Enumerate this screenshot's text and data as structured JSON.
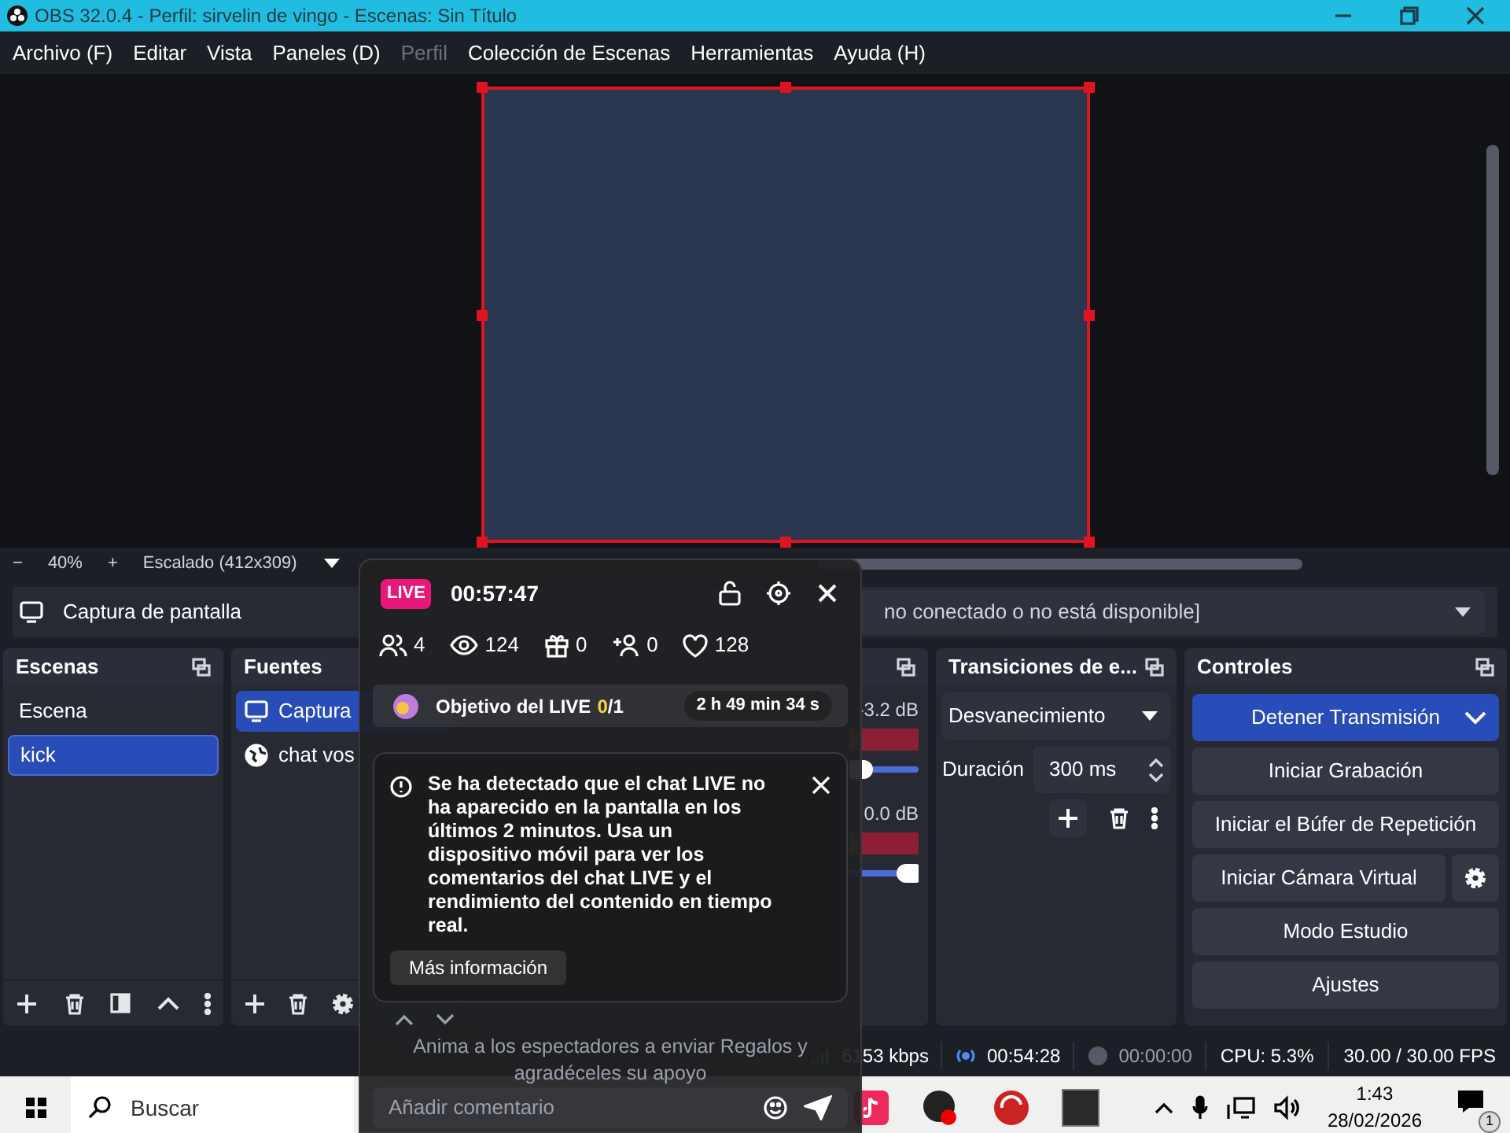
{
  "window": {
    "title": "OBS 32.0.4 - Perfil: sirvelin de vingo - Escenas: Sin Título"
  },
  "menu": [
    {
      "label": "Archivo (F)",
      "disabled": false
    },
    {
      "label": "Editar",
      "disabled": false
    },
    {
      "label": "Vista",
      "disabled": false
    },
    {
      "label": "Paneles (D)",
      "disabled": false
    },
    {
      "label": "Perfil",
      "disabled": true
    },
    {
      "label": "Colección de Escenas",
      "disabled": false
    },
    {
      "label": "Herramientas",
      "disabled": false
    },
    {
      "label": "Ayuda (H)",
      "disabled": false
    }
  ],
  "preview": {
    "zoom_out": "−",
    "zoom": "40%",
    "zoom_in": "+",
    "scale": "Escalado (412x309)"
  },
  "source_toolbar": {
    "source": "Captura de pantalla",
    "device": "no conectado o no está disponible]"
  },
  "scenes": {
    "title": "Escenas",
    "items": [
      {
        "label": "Escena",
        "selected": false
      },
      {
        "label": "kick",
        "selected": true
      }
    ]
  },
  "sources": {
    "title": "Fuentes",
    "items": [
      {
        "label": "Captura",
        "kind": "display",
        "selected": true
      },
      {
        "label": "chat vos",
        "kind": "browser",
        "selected": false
      }
    ]
  },
  "mixer": {
    "channels": [
      {
        "reading": "-3.2 dB",
        "level": 0.86
      },
      {
        "reading": "0.0 dB",
        "level": 0.98
      }
    ]
  },
  "transitions": {
    "title": "Transiciones de e...",
    "transition": "Desvanecimiento",
    "duration_label": "Duración",
    "duration": "300 ms"
  },
  "controls": {
    "title": "Controles",
    "buttons": [
      {
        "label": "Detener Transmisión",
        "kind": "primary"
      },
      {
        "label": "Iniciar Grabación",
        "kind": "plain"
      },
      {
        "label": "Iniciar el Búfer de Repetición",
        "kind": "plain"
      },
      {
        "label": "Iniciar Cámara Virtual",
        "kind": "settings"
      },
      {
        "label": "Modo Estudio",
        "kind": "plain"
      },
      {
        "label": "Ajustes",
        "kind": "plain"
      }
    ]
  },
  "status_bar": {
    "bitrate": "6153 kbps",
    "stream_time": "00:54:28",
    "record_time": "00:00:00",
    "cpu": "CPU: 5.3%",
    "fps": "30.00 / 30.00 FPS"
  },
  "live_overlay": {
    "badge": "LIVE",
    "time": "00:57:47",
    "stats": [
      {
        "kind": "people",
        "value": "4"
      },
      {
        "kind": "views",
        "value": "124"
      },
      {
        "kind": "gifts",
        "value": "0"
      },
      {
        "kind": "followers",
        "value": "0"
      },
      {
        "kind": "likes",
        "value": "128"
      }
    ],
    "goal": {
      "label": "Objetivo del LIVE",
      "current": "0",
      "total": "/1",
      "time": "2 h 49 min 34 s"
    },
    "notice": {
      "text": "Se ha detectado que el chat LIVE no ha aparecido en la pantalla en los últimos 2 minutos. Usa un dispositivo móvil para ver los comentarios del chat LIVE y el rendimiento del contenido en tiempo real.",
      "button": "Más información"
    },
    "prompt": "Anima a los espectadores a enviar Regalos y agradéceles su apoyo",
    "comment_placeholder": "Añadir comentario"
  },
  "taskbar": {
    "search_placeholder": "Buscar",
    "time": "1:43",
    "date": "28/02/2026",
    "notifications": "1"
  }
}
